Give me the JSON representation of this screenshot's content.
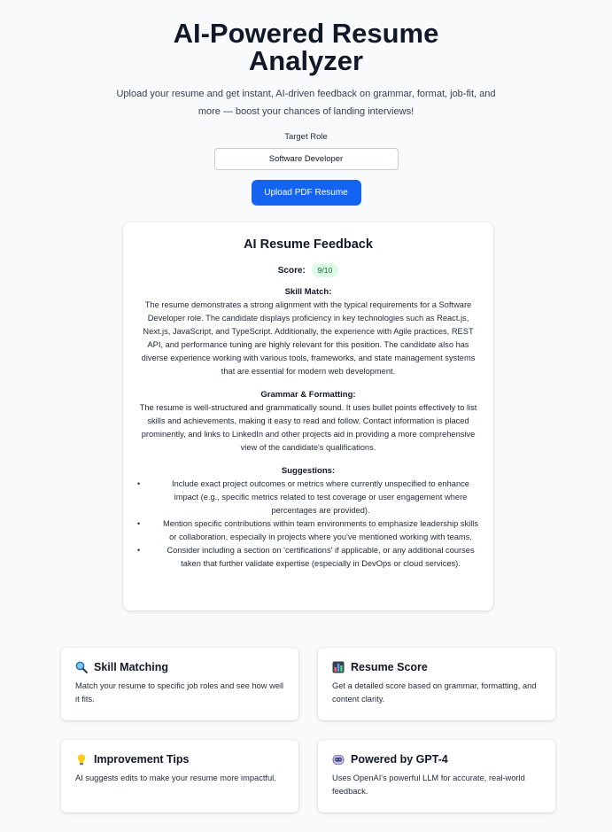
{
  "header": {
    "title": "AI-Powered Resume Analyzer",
    "subtitle": "Upload your resume and get instant, AI-driven feedback on grammar, format, job-fit, and more — boost your chances of landing interviews!"
  },
  "form": {
    "target_role_label": "Target Role",
    "target_role_value": "Software Developer",
    "upload_button_label": "Upload PDF Resume"
  },
  "feedback": {
    "title": "AI Resume Feedback",
    "score_label": "Score:",
    "score_value": "9/10",
    "sections": {
      "skill_match": {
        "heading": "Skill Match:",
        "text": "The resume demonstrates a strong alignment with the typical requirements for a Software Developer role. The candidate displays proficiency in key technologies such as React.js, Next.js, JavaScript, and TypeScript. Additionally, the experience with Agile practices, REST API, and performance tuning are highly relevant for this position. The candidate also has diverse experience working with various tools, frameworks, and state management systems that are essential for modern web development."
      },
      "grammar": {
        "heading": "Grammar & Formatting:",
        "text": "The resume is well-structured and grammatically sound. It uses bullet points effectively to list skills and achievements, making it easy to read and follow. Contact information is placed prominently, and links to LinkedIn and other projects aid in providing a more comprehensive view of the candidate's qualifications."
      },
      "suggestions": {
        "heading": "Suggestions:",
        "bullet": "•",
        "items": [
          "Include exact project outcomes or metrics where currently unspecified to enhance impact (e.g., specific metrics related to test coverage or user engagement where percentages are provided).",
          "Mention specific contributions within team environments to emphasize leadership skills or collaboration, especially in projects where you've mentioned working with teams.",
          "Consider including a section on 'certifications' if applicable, or any additional courses taken that further validate expertise (especially in DevOps or cloud services)."
        ]
      }
    }
  },
  "features": [
    {
      "icon": "magnifying-glass-icon",
      "title": "Skill Matching",
      "description": "Match your resume to specific job roles and see how well it fits."
    },
    {
      "icon": "bar-chart-icon",
      "title": "Resume Score",
      "description": "Get a detailed score based on grammar, formatting, and content clarity."
    },
    {
      "icon": "light-bulb-icon",
      "title": "Improvement Tips",
      "description": "AI suggests edits to make your resume more impactful."
    },
    {
      "icon": "robot-icon",
      "title": "Powered by GPT-4",
      "description": "Uses OpenAI's powerful LLM for accurate, real-world feedback."
    }
  ],
  "colors": {
    "accent": "#1463f3",
    "badge_bg": "#dcfce7",
    "badge_text": "#166534",
    "page_bg": "#f8fafc"
  }
}
